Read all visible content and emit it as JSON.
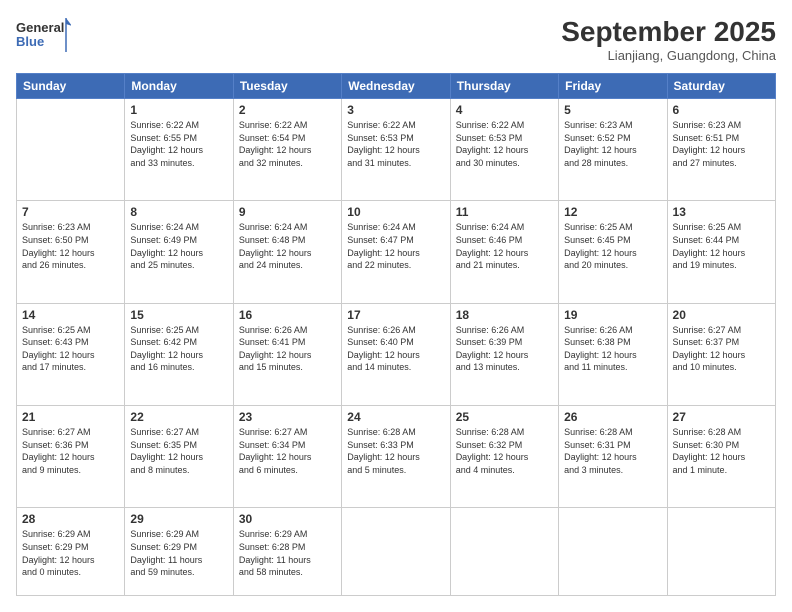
{
  "header": {
    "logo_general": "General",
    "logo_blue": "Blue",
    "month_title": "September 2025",
    "location": "Lianjiang, Guangdong, China"
  },
  "days_of_week": [
    "Sunday",
    "Monday",
    "Tuesday",
    "Wednesday",
    "Thursday",
    "Friday",
    "Saturday"
  ],
  "weeks": [
    [
      {
        "day": "",
        "info": ""
      },
      {
        "day": "1",
        "info": "Sunrise: 6:22 AM\nSunset: 6:55 PM\nDaylight: 12 hours\nand 33 minutes."
      },
      {
        "day": "2",
        "info": "Sunrise: 6:22 AM\nSunset: 6:54 PM\nDaylight: 12 hours\nand 32 minutes."
      },
      {
        "day": "3",
        "info": "Sunrise: 6:22 AM\nSunset: 6:53 PM\nDaylight: 12 hours\nand 31 minutes."
      },
      {
        "day": "4",
        "info": "Sunrise: 6:22 AM\nSunset: 6:53 PM\nDaylight: 12 hours\nand 30 minutes."
      },
      {
        "day": "5",
        "info": "Sunrise: 6:23 AM\nSunset: 6:52 PM\nDaylight: 12 hours\nand 28 minutes."
      },
      {
        "day": "6",
        "info": "Sunrise: 6:23 AM\nSunset: 6:51 PM\nDaylight: 12 hours\nand 27 minutes."
      }
    ],
    [
      {
        "day": "7",
        "info": "Sunrise: 6:23 AM\nSunset: 6:50 PM\nDaylight: 12 hours\nand 26 minutes."
      },
      {
        "day": "8",
        "info": "Sunrise: 6:24 AM\nSunset: 6:49 PM\nDaylight: 12 hours\nand 25 minutes."
      },
      {
        "day": "9",
        "info": "Sunrise: 6:24 AM\nSunset: 6:48 PM\nDaylight: 12 hours\nand 24 minutes."
      },
      {
        "day": "10",
        "info": "Sunrise: 6:24 AM\nSunset: 6:47 PM\nDaylight: 12 hours\nand 22 minutes."
      },
      {
        "day": "11",
        "info": "Sunrise: 6:24 AM\nSunset: 6:46 PM\nDaylight: 12 hours\nand 21 minutes."
      },
      {
        "day": "12",
        "info": "Sunrise: 6:25 AM\nSunset: 6:45 PM\nDaylight: 12 hours\nand 20 minutes."
      },
      {
        "day": "13",
        "info": "Sunrise: 6:25 AM\nSunset: 6:44 PM\nDaylight: 12 hours\nand 19 minutes."
      }
    ],
    [
      {
        "day": "14",
        "info": "Sunrise: 6:25 AM\nSunset: 6:43 PM\nDaylight: 12 hours\nand 17 minutes."
      },
      {
        "day": "15",
        "info": "Sunrise: 6:25 AM\nSunset: 6:42 PM\nDaylight: 12 hours\nand 16 minutes."
      },
      {
        "day": "16",
        "info": "Sunrise: 6:26 AM\nSunset: 6:41 PM\nDaylight: 12 hours\nand 15 minutes."
      },
      {
        "day": "17",
        "info": "Sunrise: 6:26 AM\nSunset: 6:40 PM\nDaylight: 12 hours\nand 14 minutes."
      },
      {
        "day": "18",
        "info": "Sunrise: 6:26 AM\nSunset: 6:39 PM\nDaylight: 12 hours\nand 13 minutes."
      },
      {
        "day": "19",
        "info": "Sunrise: 6:26 AM\nSunset: 6:38 PM\nDaylight: 12 hours\nand 11 minutes."
      },
      {
        "day": "20",
        "info": "Sunrise: 6:27 AM\nSunset: 6:37 PM\nDaylight: 12 hours\nand 10 minutes."
      }
    ],
    [
      {
        "day": "21",
        "info": "Sunrise: 6:27 AM\nSunset: 6:36 PM\nDaylight: 12 hours\nand 9 minutes."
      },
      {
        "day": "22",
        "info": "Sunrise: 6:27 AM\nSunset: 6:35 PM\nDaylight: 12 hours\nand 8 minutes."
      },
      {
        "day": "23",
        "info": "Sunrise: 6:27 AM\nSunset: 6:34 PM\nDaylight: 12 hours\nand 6 minutes."
      },
      {
        "day": "24",
        "info": "Sunrise: 6:28 AM\nSunset: 6:33 PM\nDaylight: 12 hours\nand 5 minutes."
      },
      {
        "day": "25",
        "info": "Sunrise: 6:28 AM\nSunset: 6:32 PM\nDaylight: 12 hours\nand 4 minutes."
      },
      {
        "day": "26",
        "info": "Sunrise: 6:28 AM\nSunset: 6:31 PM\nDaylight: 12 hours\nand 3 minutes."
      },
      {
        "day": "27",
        "info": "Sunrise: 6:28 AM\nSunset: 6:30 PM\nDaylight: 12 hours\nand 1 minute."
      }
    ],
    [
      {
        "day": "28",
        "info": "Sunrise: 6:29 AM\nSunset: 6:29 PM\nDaylight: 12 hours\nand 0 minutes."
      },
      {
        "day": "29",
        "info": "Sunrise: 6:29 AM\nSunset: 6:29 PM\nDaylight: 11 hours\nand 59 minutes."
      },
      {
        "day": "30",
        "info": "Sunrise: 6:29 AM\nSunset: 6:28 PM\nDaylight: 11 hours\nand 58 minutes."
      },
      {
        "day": "",
        "info": ""
      },
      {
        "day": "",
        "info": ""
      },
      {
        "day": "",
        "info": ""
      },
      {
        "day": "",
        "info": ""
      }
    ]
  ]
}
